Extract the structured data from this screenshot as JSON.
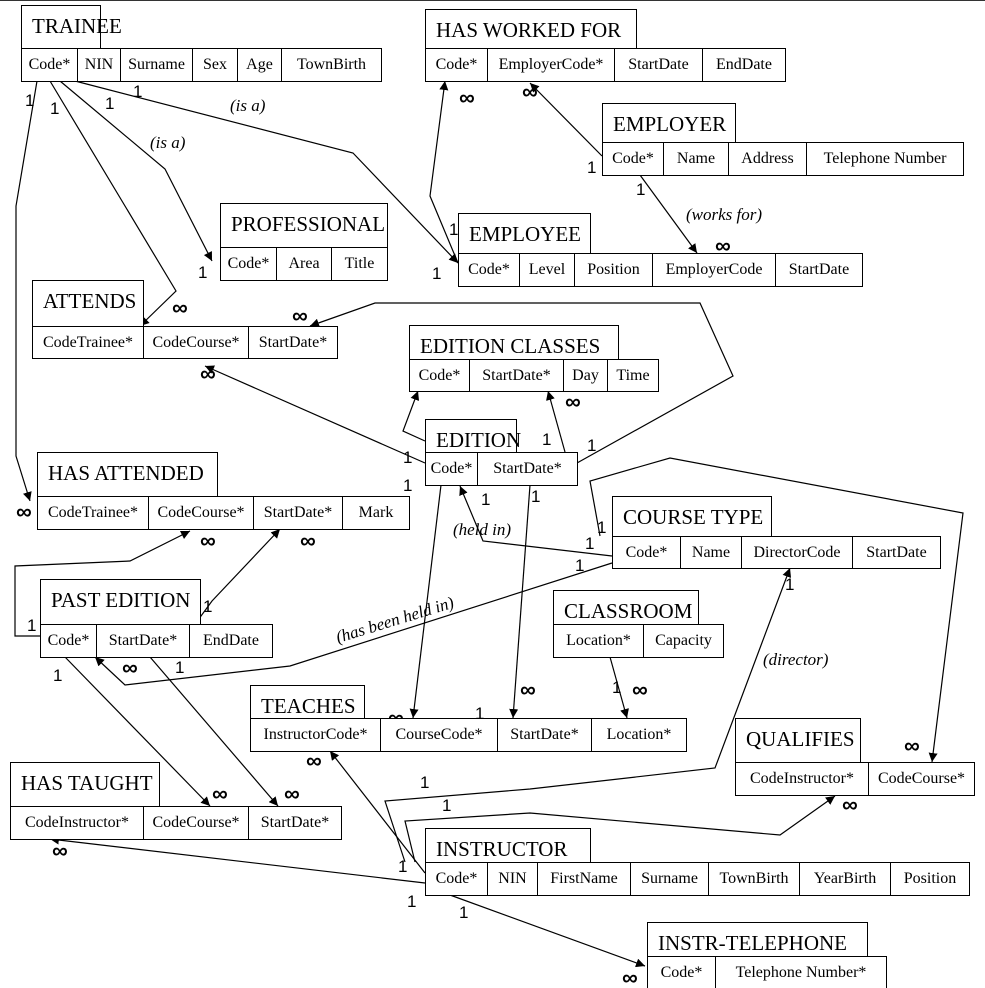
{
  "entities": [
    {
      "name": "TRAINEE",
      "attributes": [
        "Code*",
        "NIN",
        "Surname",
        "Sex",
        "Age",
        "TownBirth"
      ]
    },
    {
      "name": "HAS WORKED FOR",
      "attributes": [
        "Code*",
        "EmployerCode*",
        "StartDate",
        "EndDate"
      ]
    },
    {
      "name": "EMPLOYER",
      "attributes": [
        "Code*",
        "Name",
        "Address",
        "Telephone Number"
      ]
    },
    {
      "name": "PROFESSIONAL",
      "attributes": [
        "Code*",
        "Area",
        "Title"
      ]
    },
    {
      "name": "EMPLOYEE",
      "attributes": [
        "Code*",
        "Level",
        "Position",
        "EmployerCode",
        "StartDate"
      ]
    },
    {
      "name": "ATTENDS",
      "attributes": [
        "CodeTrainee*",
        "CodeCourse*",
        "StartDate*"
      ]
    },
    {
      "name": "EDITION CLASSES",
      "attributes": [
        "Code*",
        "StartDate*",
        "Day",
        "Time"
      ]
    },
    {
      "name": "EDITION",
      "attributes": [
        "Code*",
        "StartDate*"
      ]
    },
    {
      "name": "HAS ATTENDED",
      "attributes": [
        "CodeTrainee*",
        "CodeCourse*",
        "StartDate*",
        "Mark"
      ]
    },
    {
      "name": "COURSE TYPE",
      "attributes": [
        "Code*",
        "Name",
        "DirectorCode",
        "StartDate"
      ]
    },
    {
      "name": "PAST EDITION",
      "attributes": [
        "Code*",
        "StartDate*",
        "EndDate"
      ]
    },
    {
      "name": "CLASSROOM",
      "attributes": [
        "Location*",
        "Capacity"
      ]
    },
    {
      "name": "TEACHES",
      "attributes": [
        "InstructorCode*",
        "CourseCode*",
        "StartDate*",
        "Location*"
      ]
    },
    {
      "name": "QUALIFIES",
      "attributes": [
        "CodeInstructor*",
        "CodeCourse*"
      ]
    },
    {
      "name": "HAS TAUGHT",
      "attributes": [
        "CodeInstructor*",
        "CodeCourse*",
        "StartDate*"
      ]
    },
    {
      "name": "INSTRUCTOR",
      "attributes": [
        "Code*",
        "NIN",
        "FirstName",
        "Surname",
        "TownBirth",
        "YearBirth",
        "Position"
      ]
    },
    {
      "name": "INSTR-TELEPHONE",
      "attributes": [
        "Code*",
        "Telephone Number*"
      ]
    }
  ],
  "labels": [
    "1",
    "1",
    "1",
    "1",
    "(is a)",
    "(is a)",
    "1",
    "∞",
    "∞",
    "1",
    "1",
    "∞",
    "∞",
    "1",
    "1",
    "(works for)",
    "∞",
    "∞",
    "∞",
    "1",
    "1",
    "1",
    "1",
    "1",
    "1",
    "(held in)",
    "1",
    "1",
    "1",
    "∞",
    "∞",
    "∞",
    "(has been held in)",
    "1",
    "1",
    "1",
    "∞",
    "1",
    "∞",
    "1",
    "∞",
    "1",
    "∞",
    "(director)",
    "1",
    "∞",
    "1",
    "1",
    "∞",
    "∞",
    "∞",
    "∞",
    "∞",
    "1",
    "1",
    "1",
    "∞"
  ]
}
